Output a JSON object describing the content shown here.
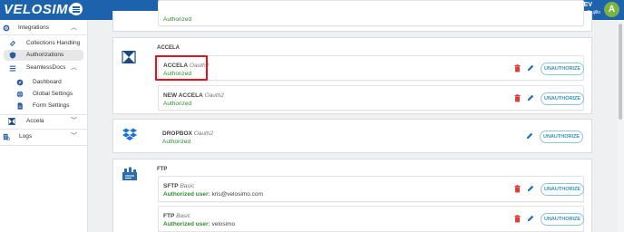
{
  "header": {
    "logo_text": "VELOSIMO",
    "env_title": "MAIN - DEV",
    "user_name": "Aidan Trujillo",
    "avatar_initial": "A",
    "brand_color": "#1c62ad"
  },
  "sidebar": {
    "integrations": "Integrations",
    "collections_handling": "Collections Handling",
    "authorizations": "Authorizations",
    "seamlessdocs": "SeamlessDocs",
    "dashboard": "Dashboard",
    "global_settings": "Global Settings",
    "form_settings": "Form Settings",
    "accela": "Accela",
    "logs": "Logs"
  },
  "main": {
    "top_partial_status": "Authorized",
    "accela_card": {
      "title": "ACCELA",
      "items": [
        {
          "name": "ACCELA",
          "type": "Oauth2",
          "status": "Authorized",
          "button": "UNAUTHORIZE"
        },
        {
          "name": "NEW ACCELA",
          "type": "Oauth2",
          "status": "Authorized",
          "button": "UNAUTHORIZE"
        }
      ]
    },
    "dropbox_card": {
      "items": [
        {
          "name": "DROPBOX",
          "type": "Oauth2",
          "status": "Authorized",
          "button": "UNAUTHORIZE"
        }
      ]
    },
    "ftp_card": {
      "title": "FTP",
      "items": [
        {
          "name": "SFTP",
          "type": "Basic",
          "status_label": "Authorized user:",
          "user": "kris@velosimo.com",
          "button": "UNAUTHORIZE"
        },
        {
          "name": "FTP",
          "type": "Basic",
          "status_label": "Authorized user:",
          "user": "velosimo",
          "button": "UNAUTHORIZE"
        }
      ]
    }
  },
  "colors": {
    "authorized_green": "#2e8b2e",
    "delete_red": "#e53935",
    "edit_blue": "#1e6fbf",
    "highlight_red": "#e0141e"
  }
}
